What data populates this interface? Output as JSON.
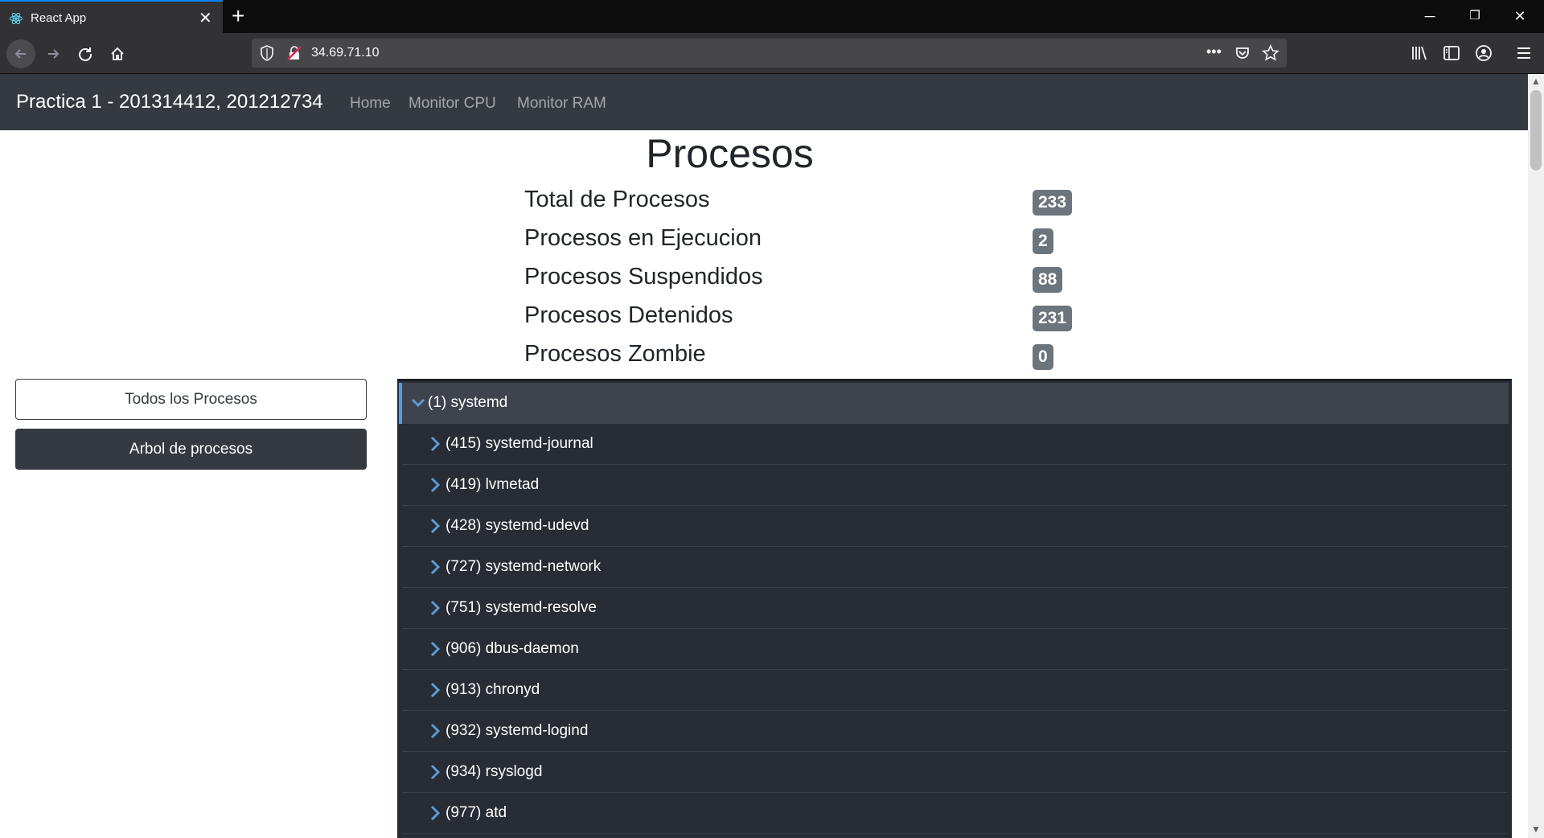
{
  "browser": {
    "tab_title": "React App",
    "url": "34.69.71.10",
    "close_tab": "✕",
    "new_tab": "+",
    "minimize": "─",
    "restore": "❐",
    "close_window": "✕"
  },
  "app": {
    "brand": "Practica 1 - 201314412, 201212734",
    "nav": [
      {
        "label": "Home"
      },
      {
        "label": "Monitor CPU"
      },
      {
        "label": "Monitor RAM"
      }
    ]
  },
  "main": {
    "heading": "Procesos",
    "stats": [
      {
        "label": "Total de Procesos",
        "value": "233"
      },
      {
        "label": "Procesos en Ejecucion",
        "value": "2"
      },
      {
        "label": "Procesos Suspendidos",
        "value": "88"
      },
      {
        "label": "Procesos Detenidos",
        "value": "231"
      },
      {
        "label": "Procesos Zombie",
        "value": "0"
      }
    ]
  },
  "sidebar": {
    "buttons": [
      {
        "label": "Todos los Procesos"
      },
      {
        "label": "Arbol de procesos"
      }
    ]
  },
  "tree": {
    "root": {
      "label": "(1) systemd",
      "expanded": true
    },
    "children": [
      {
        "label": "(415) systemd-journal"
      },
      {
        "label": "(419) lvmetad"
      },
      {
        "label": "(428) systemd-udevd"
      },
      {
        "label": "(727) systemd-network"
      },
      {
        "label": "(751) systemd-resolve"
      },
      {
        "label": "(906) dbus-daemon"
      },
      {
        "label": "(913) chronyd"
      },
      {
        "label": "(932) systemd-logind"
      },
      {
        "label": "(934) rsyslogd"
      },
      {
        "label": "(977) atd"
      }
    ]
  },
  "colors": {
    "navbar": "#343a40",
    "tree_bg": "#282c34",
    "chevron": "#5b9bd5",
    "badge": "#6c757d"
  }
}
